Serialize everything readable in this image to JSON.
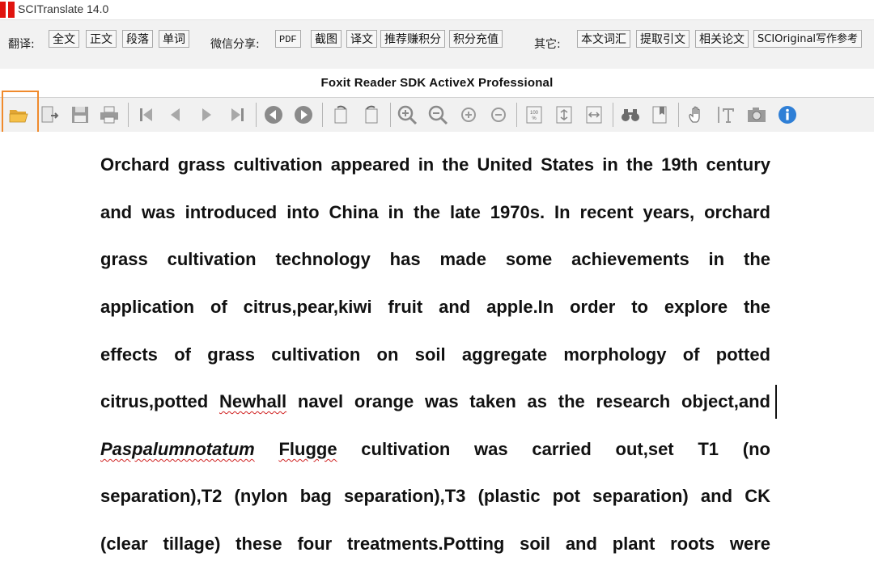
{
  "app": {
    "title": "SCITranslate 14.0"
  },
  "commands": {
    "translate": {
      "label": "翻译:",
      "buttons": [
        "全文",
        "正文",
        "段落",
        "单词"
      ]
    },
    "wechat": {
      "label": "微信分享:",
      "buttons": [
        "PDF",
        "截图",
        "译文",
        "推荐赚积分",
        "积分充值"
      ]
    },
    "other": {
      "label": "其它:",
      "buttons": [
        "本文词汇",
        "提取引文",
        "相关论文",
        "SCIOriginal写作参考"
      ]
    }
  },
  "viewer": {
    "title": "Foxit Reader SDK ActiveX Professional"
  },
  "document": {
    "lines": [
      "Orchard grass cultivation appeared in the United States in the 19th century",
      "and was introduced into China in the late 1970s. In recent years, orchard",
      "grass cultivation technology has made some achievements in the",
      "application of citrus,pear,kiwi fruit and apple.In order to explore the",
      "effects of grass cultivation on soil aggregate morphology of potted",
      [
        "citrus,potted ",
        "Newhall",
        " navel orange was taken as the research object,and"
      ],
      [
        "Paspalumnotatum",
        " ",
        "Flugge",
        " cultivation was carried out,set T1 (no"
      ],
      "separation),T2 (nylon bag separation),T3 (plastic pot separation) and CK",
      "(clear tillage) these four treatments.Potting soil and plant roots were"
    ]
  },
  "colors": {
    "accent_highlight": "#f08a2c",
    "logo_red": "#e0140f",
    "spell_underline": "#d02020"
  }
}
